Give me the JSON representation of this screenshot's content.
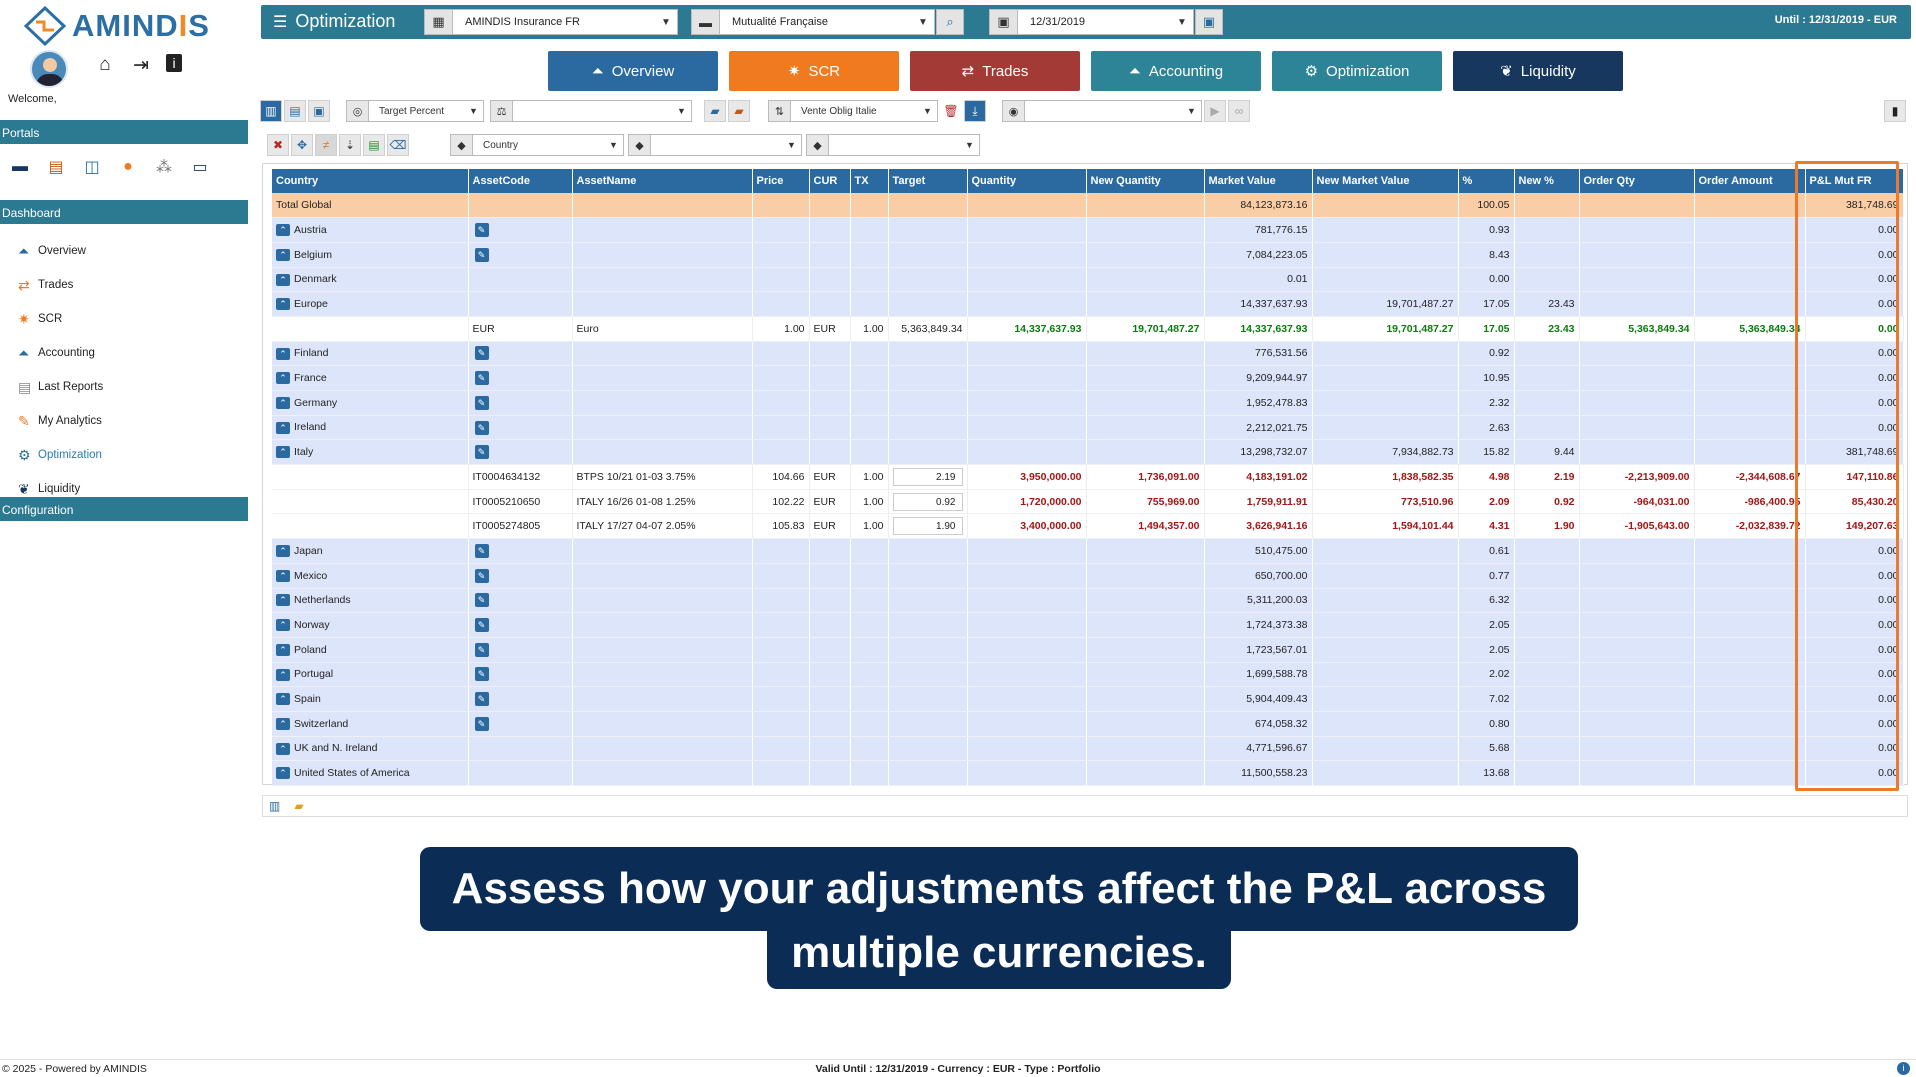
{
  "brand": {
    "logo_text_a": "AMIND",
    "logo_text_o": "I",
    "logo_text_b": "S"
  },
  "user": {
    "welcome": "Welcome,"
  },
  "sidebar": {
    "portals_header": "Portals",
    "dashboard_header": "Dashboard",
    "configuration_header": "Configuration",
    "items": [
      {
        "label": "Overview",
        "icon": "overview-icon",
        "glyph": "⏶"
      },
      {
        "label": "Trades",
        "icon": "trades-icon",
        "glyph": "⇄"
      },
      {
        "label": "SCR",
        "icon": "scr-icon",
        "glyph": "✷"
      },
      {
        "label": "Accounting",
        "icon": "accounting-icon",
        "glyph": "⏶"
      },
      {
        "label": "Last Reports",
        "icon": "reports-icon",
        "glyph": "▤"
      },
      {
        "label": "My Analytics",
        "icon": "analytics-icon",
        "glyph": "✎"
      },
      {
        "label": "Optimization",
        "icon": "gear-icon",
        "glyph": "⚙"
      },
      {
        "label": "Liquidity",
        "icon": "liquidity-icon",
        "glyph": "❦"
      }
    ]
  },
  "topbar": {
    "title": "Optimization",
    "entity": "AMINDIS Insurance FR",
    "portfolio": "Mutualité Française",
    "date": "12/31/2019",
    "until": "Until : 12/31/2019 - EUR"
  },
  "tabs": [
    {
      "label": "Overview",
      "glyph": "⏶",
      "color": "#2a6aa0"
    },
    {
      "label": "SCR",
      "glyph": "✷",
      "color": "#f07a1f"
    },
    {
      "label": "Trades",
      "glyph": "⇄",
      "color": "#a33a35"
    },
    {
      "label": "Accounting",
      "glyph": "⏶",
      "color": "#2d8496"
    },
    {
      "label": "Optimization",
      "glyph": "⚙",
      "color": "#2d8496"
    },
    {
      "label": "Liquidity",
      "glyph": "❦",
      "color": "#17375e"
    }
  ],
  "toolbar": {
    "mode": "Target Percent",
    "scenario": "Vente Oblig Italie",
    "group_by": "Country"
  },
  "table": {
    "columns": [
      "Country",
      "AssetCode",
      "AssetName",
      "Price",
      "CUR",
      "TX",
      "Target",
      "Quantity",
      "New Quantity",
      "Market Value",
      "New Market Value",
      "%",
      "New %",
      "Order Qty",
      "Order Amount",
      "P&L Mut FR"
    ],
    "rows": [
      {
        "type": "total",
        "country": "Total Global",
        "market_value": "84,123,873.16",
        "pct": "100.05",
        "pl": "381,748.69"
      },
      {
        "type": "country",
        "country": "Austria",
        "edit": true,
        "market_value": "781,776.15",
        "pct": "0.93",
        "pl": "0.00"
      },
      {
        "type": "country",
        "country": "Belgium",
        "edit": true,
        "market_value": "7,084,223.05",
        "pct": "8.43",
        "pl": "0.00"
      },
      {
        "type": "country",
        "country": "Denmark",
        "edit": false,
        "market_value": "0.01",
        "pct": "0.00",
        "pl": "0.00"
      },
      {
        "type": "country",
        "country": "Europe",
        "edit": false,
        "market_value": "14,337,637.93",
        "new_market_value": "19,701,487.27",
        "pct": "17.05",
        "new_pct": "23.43",
        "pl": "0.00"
      },
      {
        "type": "asset",
        "color": "green",
        "code": "EUR",
        "name": "Euro",
        "price": "1.00",
        "cur": "EUR",
        "tx": "1.00",
        "target_text": "5,363,849.34",
        "quantity": "14,337,637.93",
        "new_quantity": "19,701,487.27",
        "market_value": "14,337,637.93",
        "new_market_value": "19,701,487.27",
        "pct": "17.05",
        "new_pct": "23.43",
        "order_qty": "5,363,849.34",
        "order_amount": "5,363,849.34",
        "pl": "0.00"
      },
      {
        "type": "country",
        "country": "Finland",
        "edit": true,
        "market_value": "776,531.56",
        "pct": "0.92",
        "pl": "0.00"
      },
      {
        "type": "country",
        "country": "France",
        "edit": true,
        "market_value": "9,209,944.97",
        "pct": "10.95",
        "pl": "0.00"
      },
      {
        "type": "country",
        "country": "Germany",
        "edit": true,
        "market_value": "1,952,478.83",
        "pct": "2.32",
        "pl": "0.00"
      },
      {
        "type": "country",
        "country": "Ireland",
        "edit": true,
        "market_value": "2,212,021.75",
        "pct": "2.63",
        "pl": "0.00"
      },
      {
        "type": "country",
        "country": "Italy",
        "edit": true,
        "market_value": "13,298,732.07",
        "new_market_value": "7,934,882.73",
        "pct": "15.82",
        "new_pct": "9.44",
        "pl": "381,748.69"
      },
      {
        "type": "asset",
        "color": "red",
        "code": "IT0004634132",
        "name": "BTPS 10/21 01-03 3.75%",
        "price": "104.66",
        "cur": "EUR",
        "tx": "1.00",
        "target_input": "2.19",
        "quantity": "3,950,000.00",
        "new_quantity": "1,736,091.00",
        "market_value": "4,183,191.02",
        "new_market_value": "1,838,582.35",
        "pct": "4.98",
        "new_pct": "2.19",
        "order_qty": "-2,213,909.00",
        "order_amount": "-2,344,608.67",
        "pl": "147,110.86"
      },
      {
        "type": "asset",
        "color": "red",
        "code": "IT0005210650",
        "name": "ITALY 16/26 01-08 1.25%",
        "price": "102.22",
        "cur": "EUR",
        "tx": "1.00",
        "target_input": "0.92",
        "quantity": "1,720,000.00",
        "new_quantity": "755,969.00",
        "market_value": "1,759,911.91",
        "new_market_value": "773,510.96",
        "pct": "2.09",
        "new_pct": "0.92",
        "order_qty": "-964,031.00",
        "order_amount": "-986,400.95",
        "pl": "85,430.20"
      },
      {
        "type": "asset",
        "color": "red",
        "code": "IT0005274805",
        "name": "ITALY 17/27 04-07 2.05%",
        "price": "105.83",
        "cur": "EUR",
        "tx": "1.00",
        "target_input": "1.90",
        "quantity": "3,400,000.00",
        "new_quantity": "1,494,357.00",
        "market_value": "3,626,941.16",
        "new_market_value": "1,594,101.44",
        "pct": "4.31",
        "new_pct": "1.90",
        "order_qty": "-1,905,643.00",
        "order_amount": "-2,032,839.72",
        "pl": "149,207.63"
      },
      {
        "type": "country",
        "country": "Japan",
        "edit": true,
        "market_value": "510,475.00",
        "pct": "0.61",
        "pl": "0.00"
      },
      {
        "type": "country",
        "country": "Mexico",
        "edit": true,
        "market_value": "650,700.00",
        "pct": "0.77",
        "pl": "0.00"
      },
      {
        "type": "country",
        "country": "Netherlands",
        "edit": true,
        "market_value": "5,311,200.03",
        "pct": "6.32",
        "pl": "0.00"
      },
      {
        "type": "country",
        "country": "Norway",
        "edit": true,
        "market_value": "1,724,373.38",
        "pct": "2.05",
        "pl": "0.00"
      },
      {
        "type": "country",
        "country": "Poland",
        "edit": true,
        "market_value": "1,723,567.01",
        "pct": "2.05",
        "pl": "0.00"
      },
      {
        "type": "country",
        "country": "Portugal",
        "edit": true,
        "market_value": "1,699,588.78",
        "pct": "2.02",
        "pl": "0.00"
      },
      {
        "type": "country",
        "country": "Spain",
        "edit": true,
        "market_value": "5,904,409.43",
        "pct": "7.02",
        "pl": "0.00"
      },
      {
        "type": "country",
        "country": "Switzerland",
        "edit": true,
        "market_value": "674,058.32",
        "pct": "0.80",
        "pl": "0.00"
      },
      {
        "type": "country",
        "country": "UK and N. Ireland",
        "edit": false,
        "market_value": "4,771,596.67",
        "pct": "5.68",
        "pl": "0.00"
      },
      {
        "type": "country",
        "country": "United States of America",
        "edit": false,
        "market_value": "11,500,558.23",
        "pct": "13.68",
        "pl": "0.00"
      }
    ]
  },
  "caption": {
    "line1": "Assess how your adjustments affect the P&L across",
    "line2": "multiple currencies."
  },
  "footer": {
    "left": "© 2025 - Powered by AMINDIS",
    "center": "Valid Until : 12/31/2019 - Currency : EUR - Type : Portfolio"
  }
}
